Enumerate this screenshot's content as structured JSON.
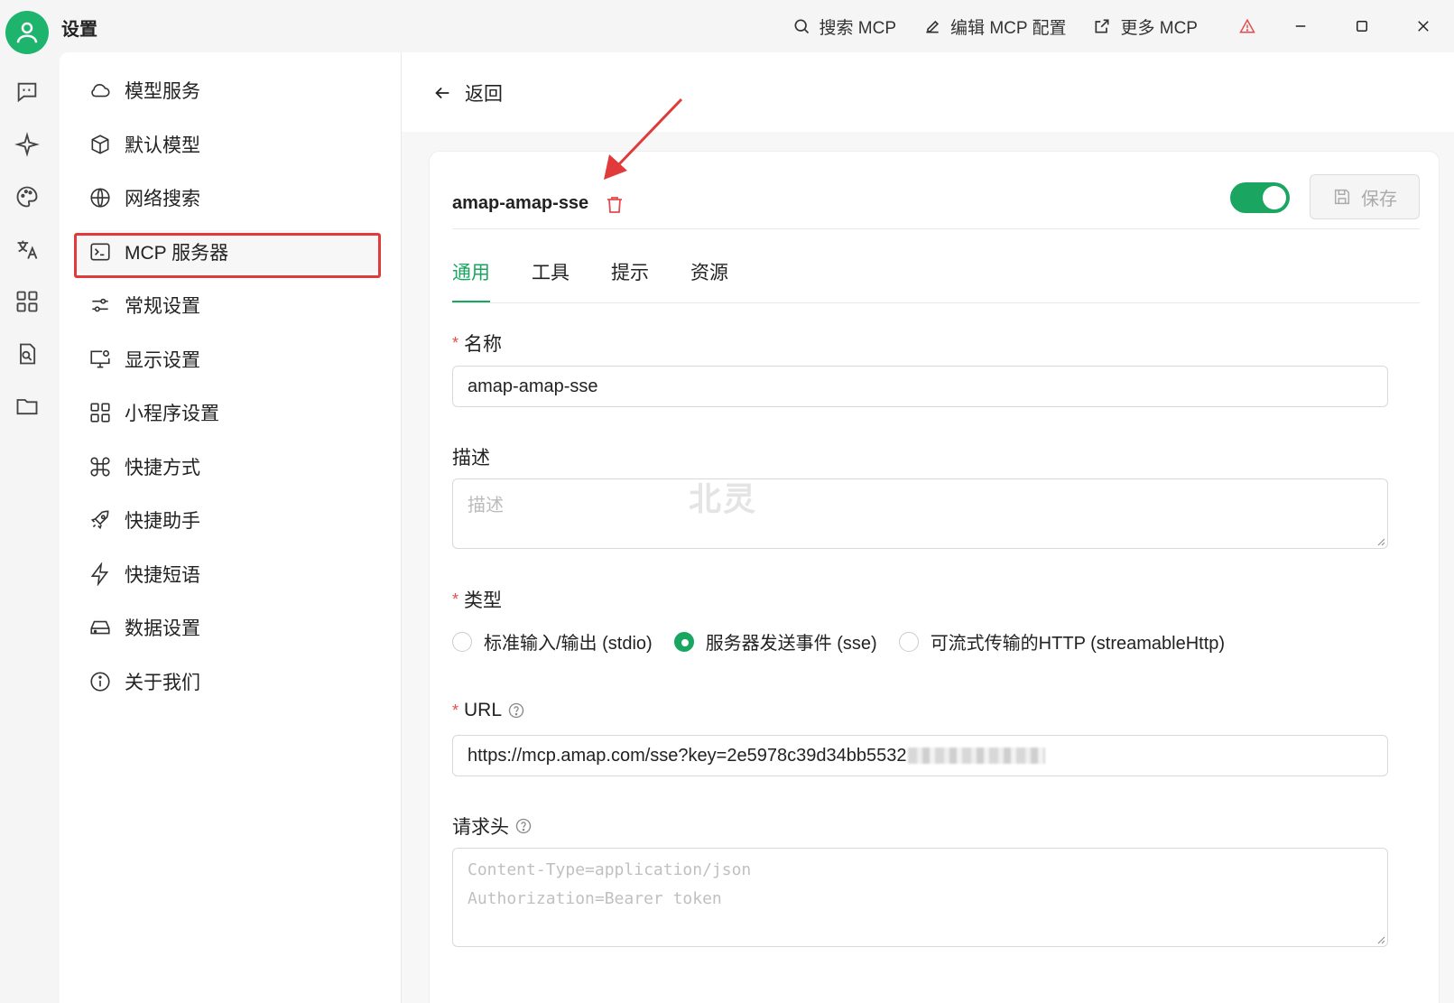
{
  "window": {
    "title": "设置",
    "actions": [
      {
        "label": "搜索 MCP",
        "icon": "search-icon"
      },
      {
        "label": "编辑 MCP 配置",
        "icon": "edit-icon"
      },
      {
        "label": "更多 MCP",
        "icon": "external-link-icon"
      }
    ]
  },
  "rail": [
    "chat-icon",
    "sparkle-icon",
    "palette-icon",
    "translate-icon",
    "apps-icon",
    "file-search-icon",
    "folder-icon"
  ],
  "menu": {
    "items": [
      {
        "label": "模型服务",
        "icon": "cloud-icon"
      },
      {
        "label": "默认模型",
        "icon": "cube-icon"
      },
      {
        "label": "网络搜索",
        "icon": "globe-icon"
      },
      {
        "label": "MCP 服务器",
        "icon": "terminal-icon",
        "active": true
      },
      {
        "label": "常规设置",
        "icon": "sliders-icon"
      },
      {
        "label": "显示设置",
        "icon": "monitor-icon"
      },
      {
        "label": "小程序设置",
        "icon": "grid-icon"
      },
      {
        "label": "快捷方式",
        "icon": "command-icon"
      },
      {
        "label": "快捷助手",
        "icon": "rocket-icon"
      },
      {
        "label": "快捷短语",
        "icon": "zap-icon"
      },
      {
        "label": "数据设置",
        "icon": "drive-icon"
      },
      {
        "label": "关于我们",
        "icon": "info-icon"
      }
    ]
  },
  "main": {
    "back_label": "返回",
    "server_name": "amap-amap-sse",
    "enabled": true,
    "save_label": "保存",
    "tabs": [
      "通用",
      "工具",
      "提示",
      "资源"
    ],
    "active_tab": "通用",
    "form": {
      "name_label": "名称",
      "name_value": "amap-amap-sse",
      "desc_label": "描述",
      "desc_placeholder": "描述",
      "type_label": "类型",
      "type_options": [
        "标准输入/输出 (stdio)",
        "服务器发送事件 (sse)",
        "可流式传输的HTTP (streamableHttp)"
      ],
      "type_selected": "服务器发送事件 (sse)",
      "url_label": "URL",
      "url_value": "https://mcp.amap.com/sse?key=2e5978c39d34bb5532",
      "headers_label": "请求头",
      "headers_placeholder_line1": "Content-Type=application/json",
      "headers_placeholder_line2": "Authorization=Bearer token"
    },
    "watermark": "北灵"
  },
  "colors": {
    "accent": "#1aa560",
    "required": "#e34d4d",
    "annotation": "#e03a3a"
  }
}
